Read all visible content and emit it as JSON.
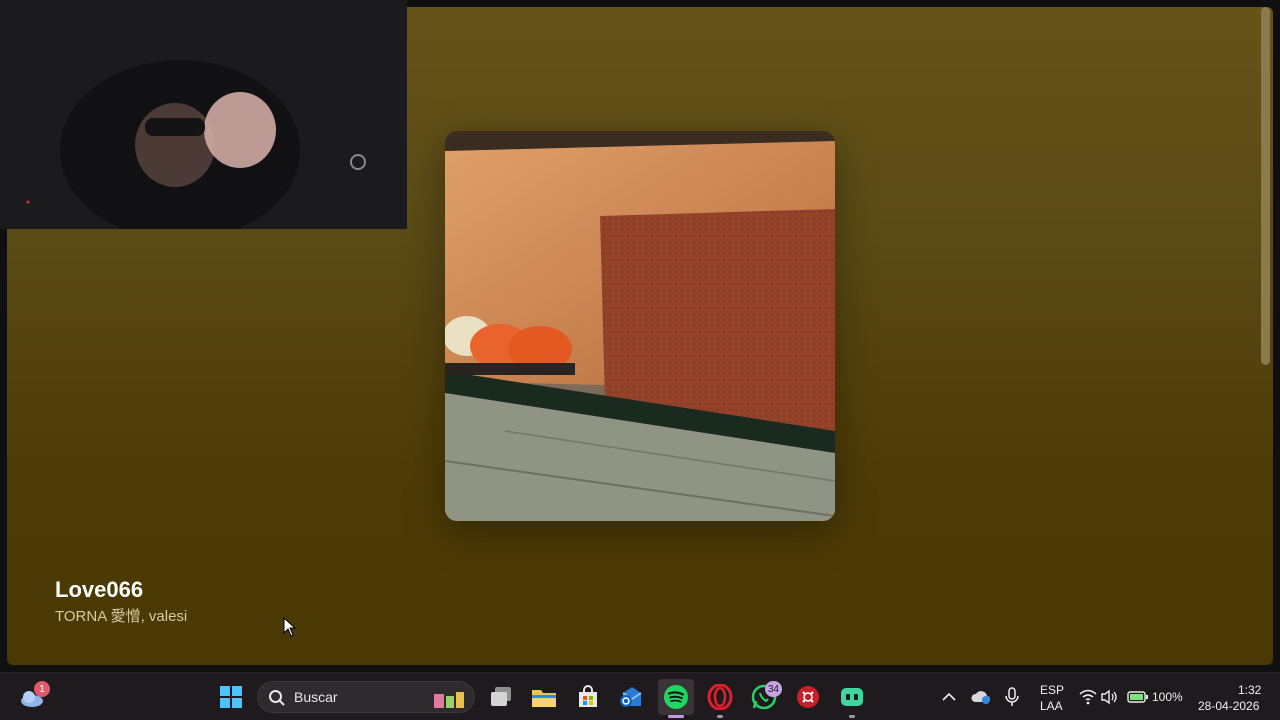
{
  "now_playing": {
    "title": "Love066",
    "artist": "TORNA 愛憎, valesi"
  },
  "taskbar": {
    "weather_badge": "1",
    "search_placeholder": "Buscar",
    "whatsapp_badge": "34",
    "language_top": "ESP",
    "language_bottom": "LAA",
    "battery": "100%",
    "time": "1:32",
    "date": "28-04-2026"
  },
  "colors": {
    "player_bg_top": "#655319",
    "player_bg_bottom": "#4a3805",
    "spotify_green": "#1ed760",
    "taskbar_bg": "#1f1a1e"
  },
  "icons": [
    "weather-icon",
    "start-icon",
    "search-icon",
    "task-view-icon",
    "file-explorer-icon",
    "microsoft-store-icon",
    "outlook-icon",
    "spotify-icon",
    "opera-icon",
    "whatsapp-icon",
    "scrcpy-icon",
    "media-player-icon",
    "chevron-up-icon",
    "cloud-icon",
    "microphone-icon",
    "wifi-icon",
    "speaker-icon",
    "battery-icon"
  ]
}
